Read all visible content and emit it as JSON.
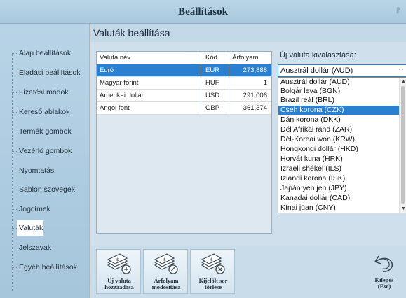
{
  "window": {
    "title": "Beállítások"
  },
  "sidebar": {
    "items": [
      {
        "label": "Alap beállítások"
      },
      {
        "label": "Eladási beállítások"
      },
      {
        "label": "Fizetési módok"
      },
      {
        "label": "Kereső ablakok"
      },
      {
        "label": "Termék gombok"
      },
      {
        "label": "Vezérlő gombok"
      },
      {
        "label": "Nyomtatás"
      },
      {
        "label": "Sablon szövegek"
      },
      {
        "label": "Jogcímek"
      },
      {
        "label": "Valuták"
      },
      {
        "label": "Jelszavak"
      },
      {
        "label": "Egyéb beállítások"
      }
    ],
    "active_index": 9
  },
  "main": {
    "section_title": "Valuták beállítása",
    "table": {
      "columns": [
        "Valuta név",
        "Kód",
        "Árfolyam"
      ],
      "rows": [
        {
          "name": "Euró",
          "code": "EUR",
          "rate": "273,888"
        },
        {
          "name": "Magyar forint",
          "code": "HUF",
          "rate": "1"
        },
        {
          "name": "Amerikai dollár",
          "code": "USD",
          "rate": "291,006"
        },
        {
          "name": "Angol font",
          "code": "GBP",
          "rate": "361,374"
        }
      ],
      "selected_index": 0
    },
    "new_currency": {
      "label": "Új valuta kiválasztása:",
      "selected": "Ausztrál dollár (AUD)",
      "options": [
        "Ausztrál dollár (AUD)",
        "Bolgár leva (BGN)",
        "Brazil reál (BRL)",
        "Cseh korona (CZK)",
        "Dán korona (DKK)",
        "Dél Afrikai rand (ZAR)",
        "Dél-Koreai won (KRW)",
        "Hongkongi dollár (HKD)",
        "Horvát kuna (HRK)",
        "Izraeli shékel (ILS)",
        "Izlandi korona (ISK)",
        "Japán yen jen (JPY)",
        "Kanadai dollár (CAD)",
        "Kínai jüan (CNY)"
      ],
      "highlighted_index": 3
    }
  },
  "toolbar": {
    "add": {
      "line1": "Új valuta",
      "line2": "hozzáadása",
      "icon": "money-add-icon"
    },
    "edit": {
      "line1": "Árfolyam",
      "line2": "módosítása",
      "icon": "money-edit-icon"
    },
    "delete": {
      "line1": "Kijelölt sor",
      "line2": "törlése",
      "icon": "money-delete-icon"
    },
    "exit": {
      "line1": "Kilépés",
      "line2": "(Esc)",
      "icon": "undo-arrow-icon"
    }
  },
  "colors": {
    "selection": "#2a7fd0",
    "sidebar": "#b8d3e6",
    "panel": "#cfe0ec"
  }
}
